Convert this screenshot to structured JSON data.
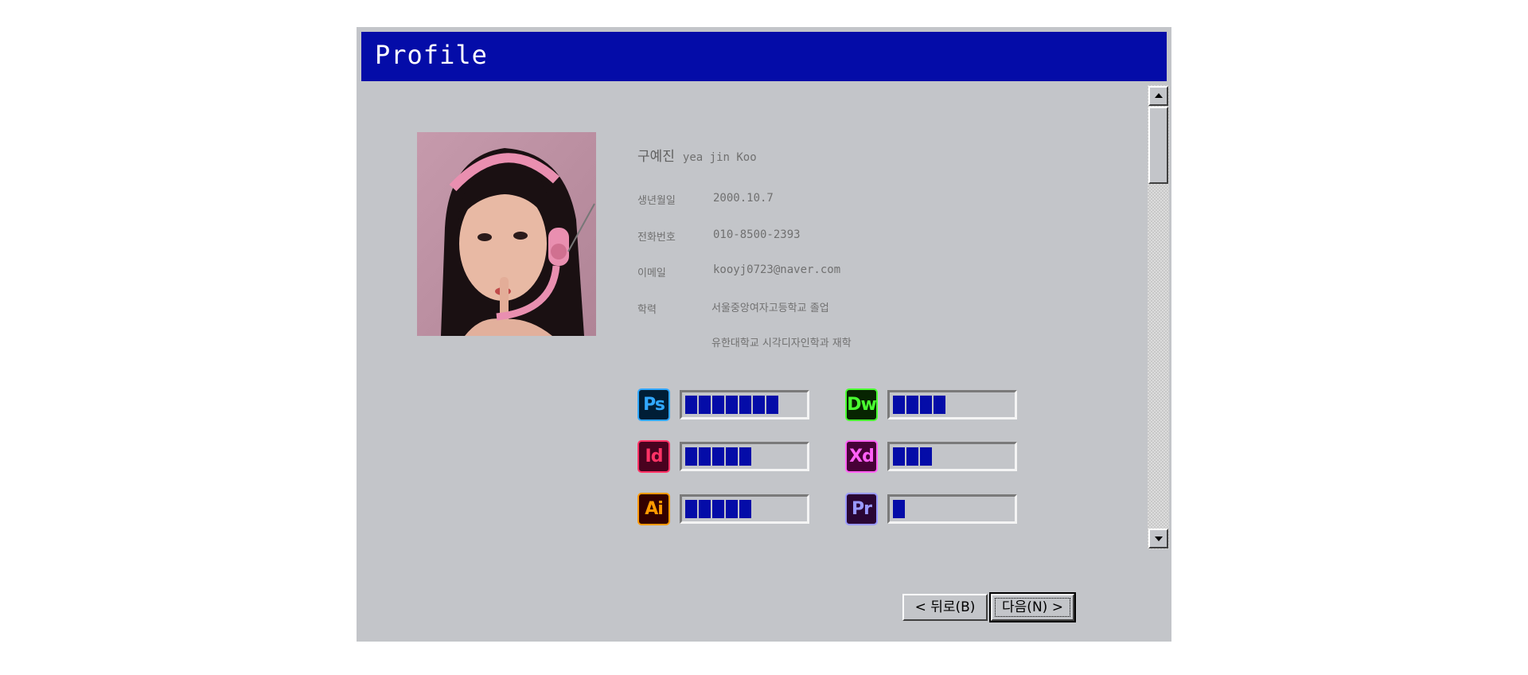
{
  "window": {
    "title": "Profile"
  },
  "profile": {
    "name_kr": "구예진",
    "name_en": "yea jin Koo",
    "fields": [
      {
        "label": "생년월일",
        "value": "2000.10.7"
      },
      {
        "label": "전화번호",
        "value": "010-8500-2393"
      },
      {
        "label": "이메일",
        "value": "kooyj0723@naver.com"
      },
      {
        "label": "학력",
        "value": "서울중앙여자고등학교 졸업"
      },
      {
        "label": "",
        "value": "유한대학교 시각디자인학과 재학"
      }
    ]
  },
  "skills": [
    {
      "abbr": "Ps",
      "icon": "photoshop-icon",
      "level": 0.67,
      "blocks": 7,
      "icon_bg": "#001e36",
      "icon_fg": "#31a8ff"
    },
    {
      "abbr": "Dw",
      "icon": "dreamweaver-icon",
      "level": 0.39,
      "blocks": 4,
      "icon_bg": "#072401",
      "icon_fg": "#4aff31"
    },
    {
      "abbr": "Id",
      "icon": "indesign-icon",
      "level": 0.48,
      "blocks": 5,
      "icon_bg": "#49021f",
      "icon_fg": "#ff3366"
    },
    {
      "abbr": "Xd",
      "icon": "xd-icon",
      "level": 0.29,
      "blocks": 3,
      "icon_bg": "#470137",
      "icon_fg": "#ff61f6"
    },
    {
      "abbr": "Ai",
      "icon": "illustrator-icon",
      "level": 0.48,
      "blocks": 5,
      "icon_bg": "#330000",
      "icon_fg": "#ff9a00"
    },
    {
      "abbr": "Pr",
      "icon": "premiere-icon",
      "level": 0.1,
      "blocks": 1,
      "icon_bg": "#2a0634",
      "icon_fg": "#9999ff"
    }
  ],
  "buttons": {
    "back": "< 뒤로(B)",
    "next": "다음(N) >"
  },
  "colors": {
    "window_bg": "#c3c5c9",
    "titlebar": "#040ca8",
    "progress_fill": "#040ca8"
  }
}
